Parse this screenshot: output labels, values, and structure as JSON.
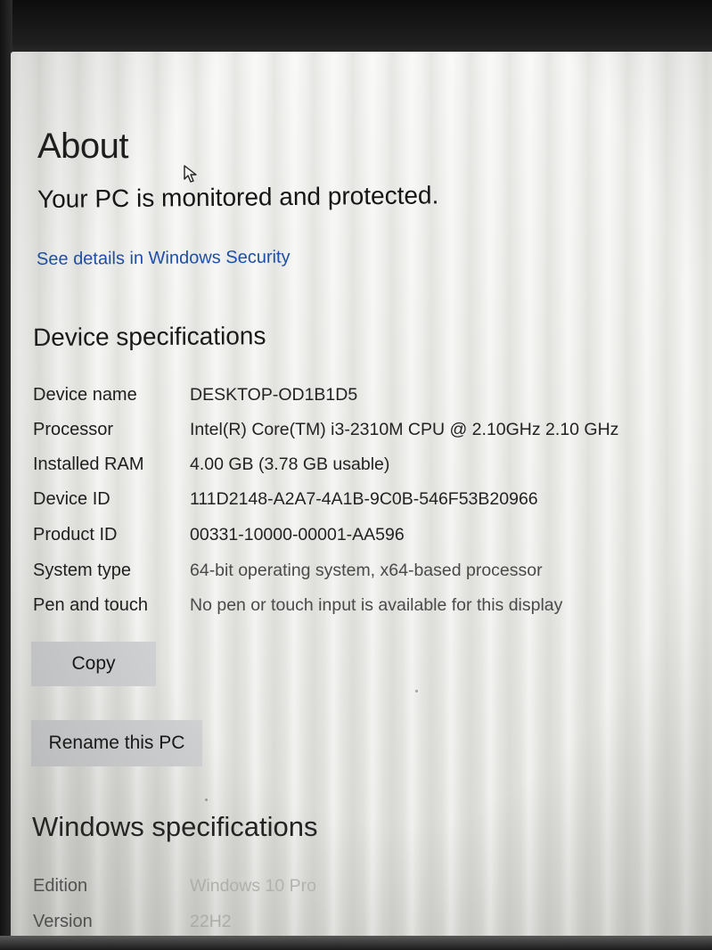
{
  "page": {
    "title": "About"
  },
  "protection": {
    "status": "Your PC is monitored and protected.",
    "link": "See details in Windows Security"
  },
  "device_specs": {
    "title": "Device specifications",
    "rows": [
      {
        "label": "Device name",
        "value": "DESKTOP-OD1B1D5"
      },
      {
        "label": "Processor",
        "value": "Intel(R) Core(TM) i3-2310M CPU @ 2.10GHz   2.10 GHz"
      },
      {
        "label": "Installed RAM",
        "value": "4.00 GB (3.78 GB usable)"
      },
      {
        "label": "Device ID",
        "value": "111D2148-A2A7-4A1B-9C0B-546F53B20966"
      },
      {
        "label": "Product ID",
        "value": "00331-10000-00001-AA596"
      },
      {
        "label": "System type",
        "value": "64-bit operating system, x64-based processor"
      },
      {
        "label": "Pen and touch",
        "value": "No pen or touch input is available for this display"
      }
    ],
    "copy_label": "Copy",
    "rename_label": "Rename this PC"
  },
  "windows_specs": {
    "title": "Windows specifications",
    "rows": [
      {
        "label": "Edition",
        "value": "Windows 10 Pro"
      },
      {
        "label": "Version",
        "value": "22H2"
      }
    ]
  },
  "icons": {
    "cursor": "mouse-pointer-icon"
  }
}
